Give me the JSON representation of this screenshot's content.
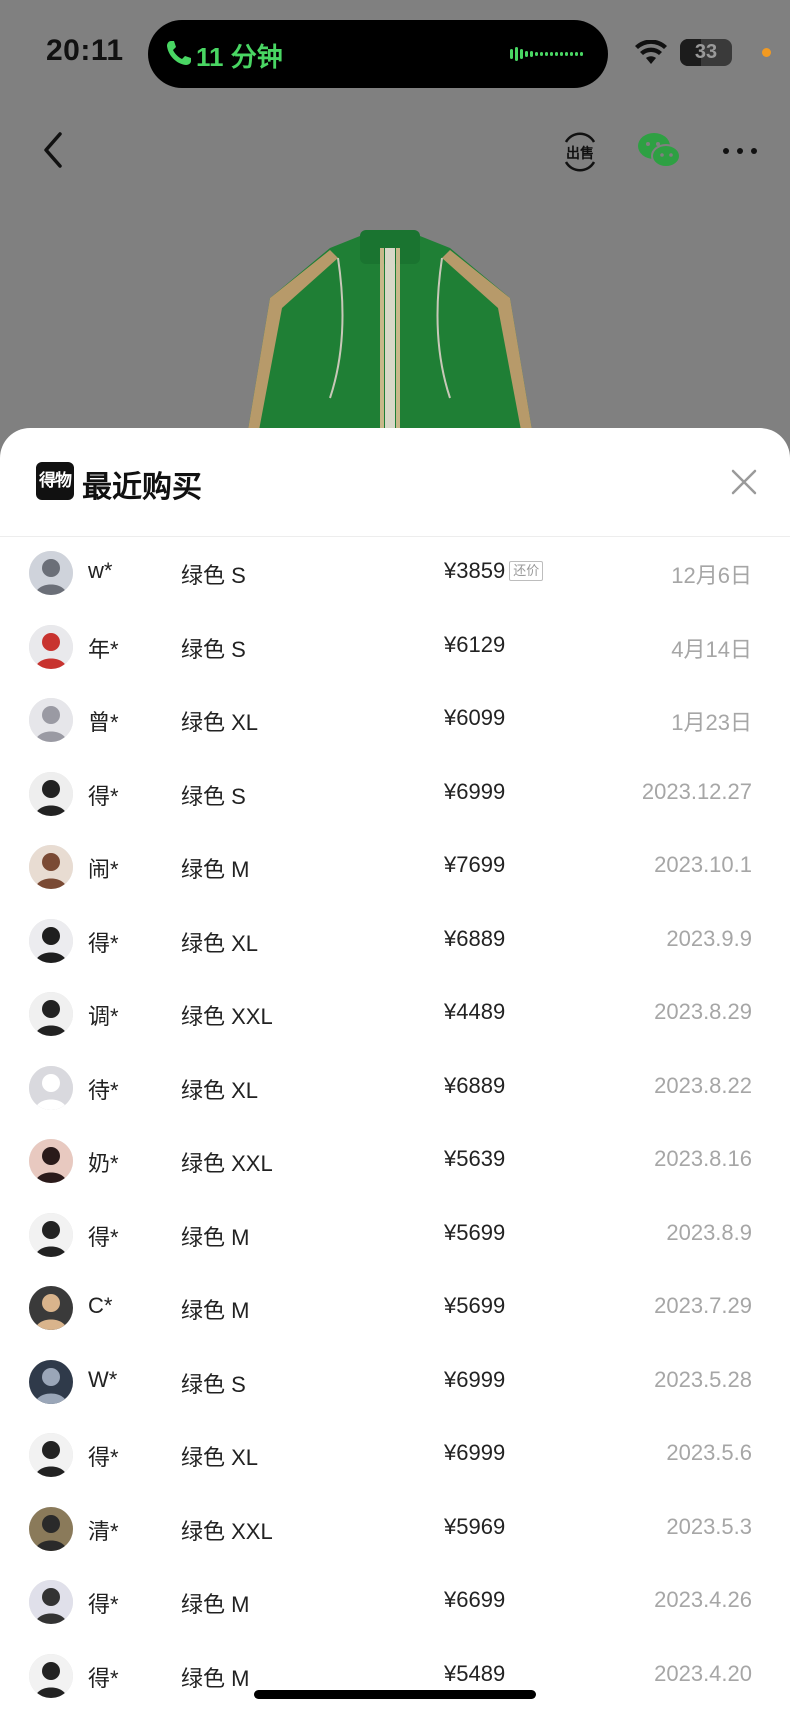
{
  "status_bar": {
    "time": "20:11",
    "call_text": "11 分钟",
    "battery": "33"
  },
  "nav": {
    "back_icon": "chevron-left-icon",
    "sell_icon": "sell-icon",
    "wechat_icon": "wechat-icon",
    "more_icon": "more-icon"
  },
  "sheet": {
    "brand": "得物",
    "title": "最近购买"
  },
  "colors": {
    "call_green": "#49d663",
    "product_green": "#1f8a3a",
    "date_gray": "#a6a6a6"
  },
  "purchases": [
    {
      "user": "w*",
      "spec": "绿色 S",
      "price": "¥3859",
      "badge": "还价",
      "date": "12月6日"
    },
    {
      "user": "年*",
      "spec": "绿色 S",
      "price": "¥6129",
      "date": "4月14日"
    },
    {
      "user": "曾*",
      "spec": "绿色 XL",
      "price": "¥6099",
      "date": "1月23日"
    },
    {
      "user": "得*",
      "spec": "绿色 S",
      "price": "¥6999",
      "date": "2023.12.27"
    },
    {
      "user": "闹*",
      "spec": "绿色 M",
      "price": "¥7699",
      "date": "2023.10.1"
    },
    {
      "user": "得*",
      "spec": "绿色 XL",
      "price": "¥6889",
      "date": "2023.9.9"
    },
    {
      "user": "调*",
      "spec": "绿色 XXL",
      "price": "¥4489",
      "date": "2023.8.29"
    },
    {
      "user": "待*",
      "spec": "绿色 XL",
      "price": "¥6889",
      "date": "2023.8.22"
    },
    {
      "user": "奶*",
      "spec": "绿色 XXL",
      "price": "¥5639",
      "date": "2023.8.16"
    },
    {
      "user": "得*",
      "spec": "绿色 M",
      "price": "¥5699",
      "date": "2023.8.9"
    },
    {
      "user": "C*",
      "spec": "绿色 M",
      "price": "¥5699",
      "date": "2023.7.29"
    },
    {
      "user": "W*",
      "spec": "绿色 S",
      "price": "¥6999",
      "date": "2023.5.28"
    },
    {
      "user": "得*",
      "spec": "绿色 XL",
      "price": "¥6999",
      "date": "2023.5.6"
    },
    {
      "user": "清*",
      "spec": "绿色 XXL",
      "price": "¥5969",
      "date": "2023.5.3"
    },
    {
      "user": "得*",
      "spec": "绿色 M",
      "price": "¥6699",
      "date": "2023.4.26"
    },
    {
      "user": "得*",
      "spec": "绿色 M",
      "price": "¥5489",
      "date": "2023.4.20"
    }
  ]
}
